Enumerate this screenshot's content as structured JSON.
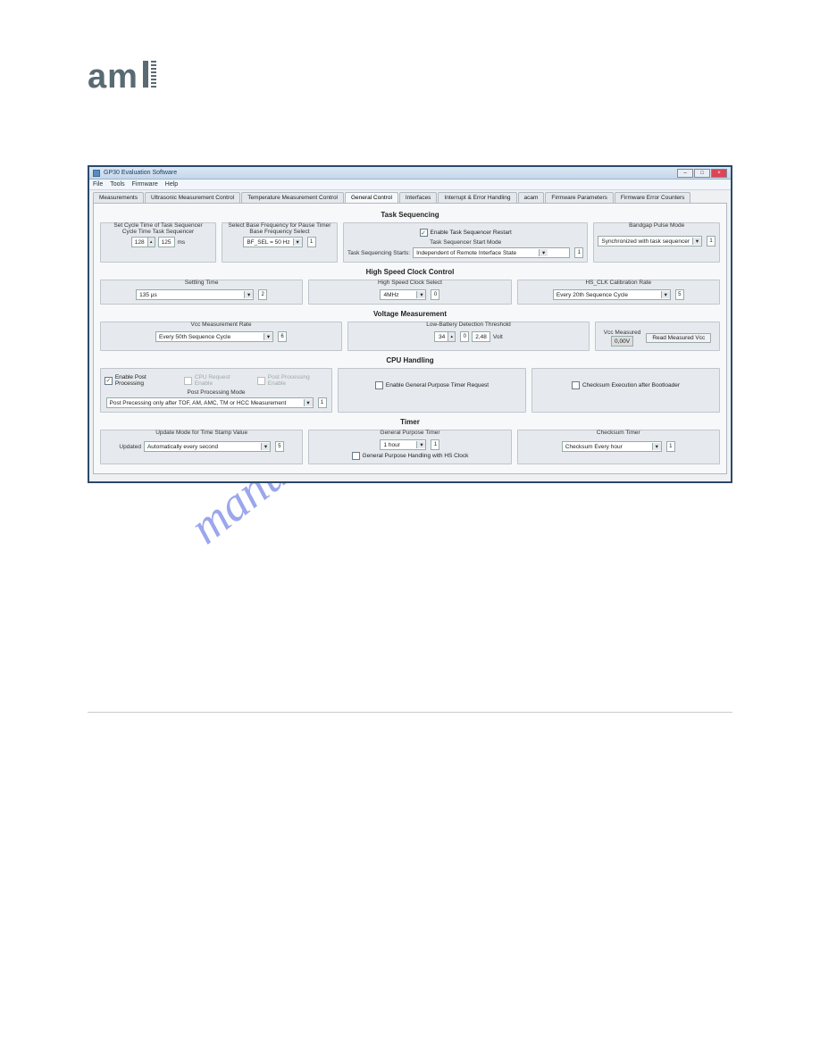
{
  "logo_text": "am",
  "watermark": "manualshive.com",
  "window": {
    "title": "GP30 Evaluation Software",
    "menus": [
      "File",
      "Tools",
      "Firmware",
      "Help"
    ],
    "winbtns": {
      "min": "–",
      "max": "□",
      "close": "×"
    }
  },
  "tabs": [
    "Measurements",
    "Ultrasonic Measurement Control",
    "Temperature Measurement Control",
    "General Control",
    "Interfaces",
    "Interrupt & Error Handling",
    "acam",
    "Firmware Parameters",
    "Firmware Error Counters"
  ],
  "active_tab": 3,
  "sections": {
    "task": {
      "title": "Task Sequencing",
      "cycle": {
        "legend": "Set Cycle Time of Task Sequencer",
        "sublabel": "Cycle Time Task Sequencer",
        "v1": "128",
        "v2": "125",
        "unit": "ms"
      },
      "base": {
        "legend": "Select Base Frequency for Pause Timer",
        "sublabel": "Base Frequency Select",
        "combo": "BF_SEL = 50 Hz",
        "idx": "1"
      },
      "restart": {
        "chk": "Enable Task Sequencer Restart",
        "checked": true,
        "mode_label": "Task Sequencer Start Mode",
        "start_label": "Task Sequencing Starts:",
        "combo": "Independent of Remote Interface State",
        "idx": "1"
      },
      "bandgap": {
        "legend": "Bandgap Pulse Mode",
        "combo": "Synchronized with task sequencer",
        "idx": "1"
      }
    },
    "hsc": {
      "title": "High Speed Clock Control",
      "settling": {
        "legend": "Settling Time",
        "combo": "135 µs",
        "idx": "2"
      },
      "select": {
        "legend": "High Speed Clock Select",
        "combo": "4MHz",
        "idx": "0"
      },
      "cal": {
        "legend": "HS_CLK Calibration Rate",
        "combo": "Every 20th Sequence Cycle",
        "idx": "5"
      }
    },
    "vm": {
      "title": "Voltage Measurement",
      "rate": {
        "legend": "Vcc Measurement Rate",
        "combo": "Every 50th Sequence Cycle",
        "idx": "6"
      },
      "lbd": {
        "legend": "Low-Battery Detection Threshold",
        "v": "34",
        "idx": "0",
        "val": "2,48",
        "unit": "Volt"
      },
      "read": {
        "label": "Vcc Measured",
        "val": "0,00V",
        "btn": "Read Measured Vcc"
      }
    },
    "cpu": {
      "title": "CPU Handling",
      "pp_enable": "Enable Post Processing",
      "cpu_req": "CPU Request Enable",
      "pp_en2": "Post Processing Enable",
      "pp_mode_legend": "Post Processing Mode",
      "pp_mode": "Post Precessing only after TOF, AM, AMC, TM or HCC Measurement",
      "pp_idx": "1",
      "gpt": "Enable General Purpose Timer Request",
      "chk_boot": "Checksum Execution after Bootloader"
    },
    "timer": {
      "title": "Timer",
      "update": {
        "legend": "Update Mode for Time Stamp Value",
        "prefix": "Updated",
        "combo": "Automatically every second",
        "idx": "5"
      },
      "gpt": {
        "legend": "General Purpose Timer",
        "combo": "1 hour",
        "idx": "1",
        "chk": "General Purpose Handling with HS Clock"
      },
      "chk": {
        "legend": "Checksum Timer",
        "combo": "Checksum Every hour",
        "idx": "1"
      }
    }
  }
}
